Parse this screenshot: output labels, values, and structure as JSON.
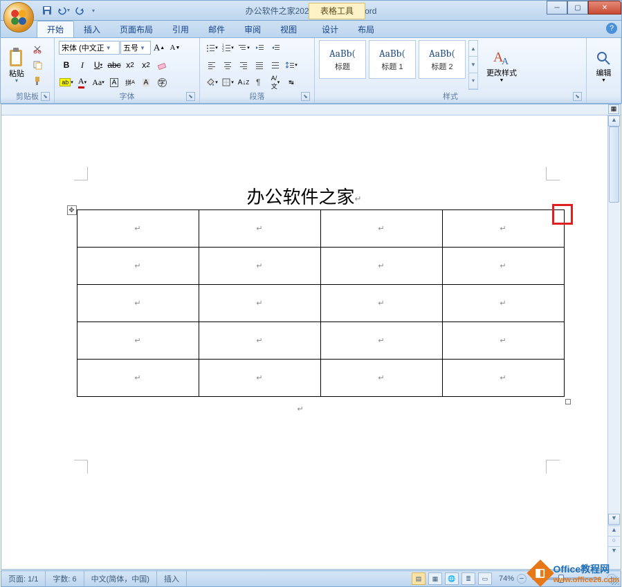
{
  "title": "办公软件之家2020 - Microsoft Word",
  "contextual_tab": "表格工具",
  "qat": {
    "save": "save-icon",
    "undo": "undo-icon",
    "redo": "redo-icon"
  },
  "tabs": [
    "开始",
    "插入",
    "页面布局",
    "引用",
    "邮件",
    "审阅",
    "视图",
    "设计",
    "布局"
  ],
  "active_tab": 0,
  "ribbon": {
    "clipboard": {
      "label": "剪贴板",
      "paste": "粘贴"
    },
    "font": {
      "label": "字体",
      "name": "宋体 (中文正",
      "size": "五号"
    },
    "paragraph": {
      "label": "段落"
    },
    "styles": {
      "label": "样式",
      "items": [
        {
          "preview": "AaBb(",
          "name": "标题"
        },
        {
          "preview": "AaBb(",
          "name": "标题 1"
        },
        {
          "preview": "AaBb(",
          "name": "标题 2"
        }
      ],
      "change": "更改样式"
    },
    "editing": {
      "label": "编辑"
    }
  },
  "document": {
    "heading": "办公软件之家",
    "table": {
      "rows": 5,
      "cols": 4,
      "cell_mark": "↵"
    },
    "para_mark": "↵"
  },
  "status": {
    "page": "页面: 1/1",
    "words": "字数: 6",
    "lang": "中文(简体，中国)",
    "mode": "插入",
    "zoom": "74%"
  },
  "watermark": {
    "line1": "Office教程网",
    "line2": "www.office26.com"
  }
}
